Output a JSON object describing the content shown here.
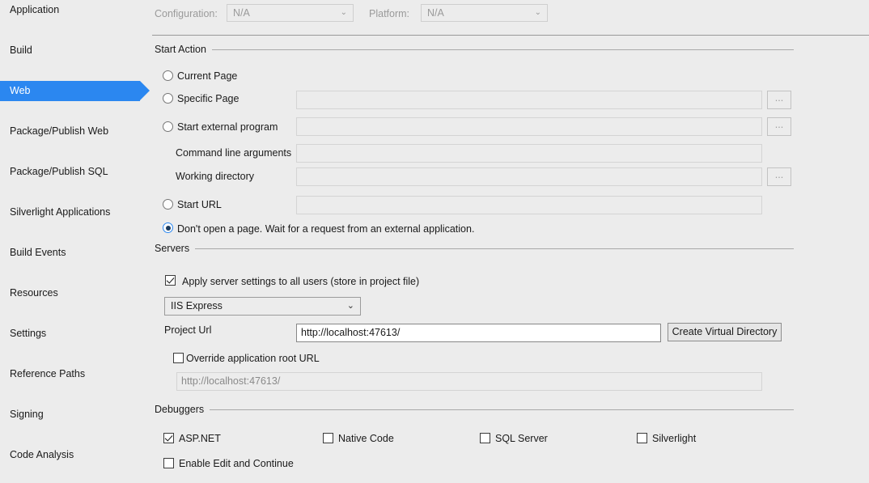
{
  "sidebar": {
    "items": [
      {
        "label": "Application",
        "selected": false
      },
      {
        "label": "Build",
        "selected": false
      },
      {
        "label": "Web",
        "selected": true
      },
      {
        "label": "Package/Publish Web",
        "selected": false
      },
      {
        "label": "Package/Publish SQL",
        "selected": false
      },
      {
        "label": "Silverlight Applications",
        "selected": false
      },
      {
        "label": "Build Events",
        "selected": false
      },
      {
        "label": "Resources",
        "selected": false
      },
      {
        "label": "Settings",
        "selected": false
      },
      {
        "label": "Reference Paths",
        "selected": false
      },
      {
        "label": "Signing",
        "selected": false
      },
      {
        "label": "Code Analysis",
        "selected": false
      }
    ],
    "selected_color": "#2b87f0"
  },
  "config_bar": {
    "configuration_label": "Configuration:",
    "configuration_value": "N/A",
    "platform_label": "Platform:",
    "platform_value": "N/A",
    "chevron": "⌄"
  },
  "start_action": {
    "group_label": "Start Action",
    "options": [
      {
        "label": "Current Page",
        "selected": false
      },
      {
        "label": "Specific Page",
        "selected": false
      },
      {
        "label": "Start external program",
        "selected": false
      },
      {
        "label": "Start URL",
        "selected": false
      },
      {
        "label": "Don't open a page.  Wait for a request from an external application.",
        "selected": true
      }
    ],
    "specific_page_value": "",
    "external_program_value": "",
    "command_line_label": "Command line arguments",
    "command_line_value": "",
    "working_directory_label": "Working directory",
    "working_directory_value": "",
    "start_url_value": "",
    "browse_label": "..."
  },
  "servers": {
    "group_label": "Servers",
    "apply_settings_label": "Apply server settings to all users (store in project file)",
    "apply_settings_checked": true,
    "server_value": "IIS Express",
    "project_url_label": "Project Url",
    "project_url_value": "http://localhost:47613/",
    "create_virtual_directory_label": "Create Virtual Directory",
    "override_label": "Override application root URL",
    "override_checked": false,
    "override_url_value": "http://localhost:47613/"
  },
  "debuggers": {
    "group_label": "Debuggers",
    "items": [
      {
        "label": "ASP.NET",
        "checked": true
      },
      {
        "label": "Native Code",
        "checked": false
      },
      {
        "label": "SQL Server",
        "checked": false
      },
      {
        "label": "Silverlight",
        "checked": false
      },
      {
        "label": "Enable Edit and Continue",
        "checked": false
      }
    ]
  }
}
